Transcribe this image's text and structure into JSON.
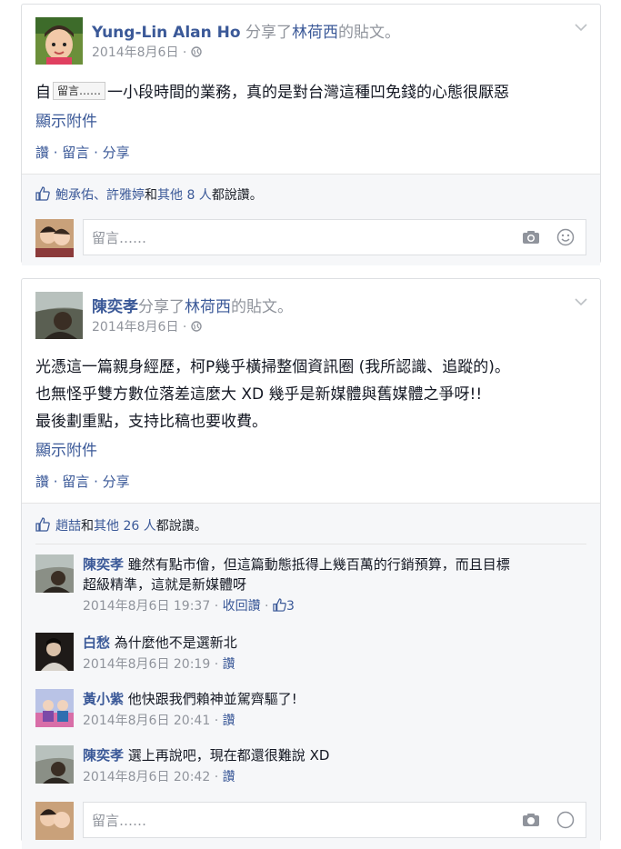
{
  "post1": {
    "author": "Yung-Lin Alan Ho",
    "shared_text": " 分享了",
    "shared_target": "林荷西",
    "shared_suffix": "的貼文。",
    "date": "2014年8月6日",
    "privacy_sep": " · ",
    "body_start": "自",
    "tooltip": "留言……",
    "body_end": "一小段時間的業務，真的是對台灣這種凹免錢的心態很厭惡",
    "attachment_link": "顯示附件",
    "actions": "讚 · 留言 · 分享",
    "likes_names": "鮑承佑、許雅婷",
    "likes_and": "和",
    "likes_others": "其他 8 人",
    "likes_suffix": "都說讚。",
    "comment_placeholder": "留言……"
  },
  "post2": {
    "author": "陳奕孝",
    "shared_text": "分享了",
    "shared_target": "林荷西",
    "shared_suffix": "的貼文。",
    "date": "2014年8月6日",
    "privacy_sep": " · ",
    "body_line1": "光憑這一篇親身經歷，柯P幾乎橫掃整個資訊圈 (我所認識、追蹤的)。",
    "body_line2": "也無怪乎雙方數位落差這麼大 XD 幾乎是新媒體與舊媒體之爭呀!!",
    "body_line3": "最後劃重點，支持比稿也要收費。",
    "attachment_link": "顯示附件",
    "actions": "讚 · 留言 · 分享",
    "likes_names": "趙喆",
    "likes_and": "和",
    "likes_others": "其他 26 人",
    "likes_suffix": "都說讚。",
    "comments": [
      {
        "name": "陳奕孝",
        "text_line1": "雖然有點市儈，但這篇動態抵得上幾百萬的行銷預算，而且目標",
        "text_line2": "超級精準，這就是新媒體呀",
        "time": "2014年8月6日 19:37",
        "action": "收回讚",
        "like_count": "3"
      },
      {
        "name": "白愁",
        "text_line1": "為什麼他不是選新北",
        "time": "2014年8月6日 20:19",
        "action": "讚"
      },
      {
        "name": "黃小紫",
        "text_line1": "他快跟我們賴神並駕齊驅了!",
        "time": "2014年8月6日 20:41",
        "action": "讚"
      },
      {
        "name": "陳奕孝",
        "text_line1": "選上再說吧，現在都還很難說 XD",
        "time": "2014年8月6日 20:42",
        "action": "讚"
      }
    ],
    "comment_placeholder": "留言……"
  }
}
